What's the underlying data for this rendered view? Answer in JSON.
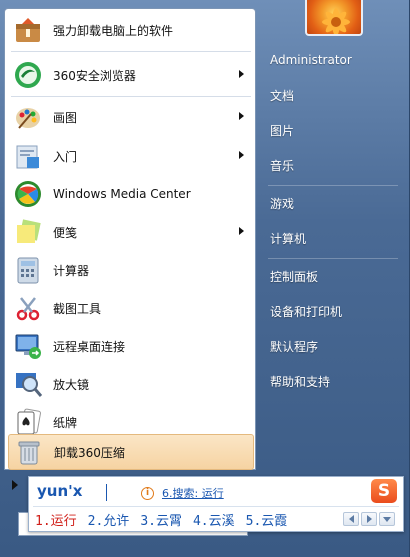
{
  "programs": [
    {
      "label": "强力卸载电脑上的软件",
      "icon": "uninstall-box-icon",
      "has_submenu": false
    },
    {
      "label": "360安全浏览器",
      "icon": "360-browser-icon",
      "has_submenu": true
    },
    {
      "label": "画图",
      "icon": "paint-palette-icon",
      "has_submenu": true
    },
    {
      "label": "入门",
      "icon": "getting-started-icon",
      "has_submenu": true
    },
    {
      "label": "Windows Media Center",
      "icon": "media-center-icon",
      "has_submenu": false
    },
    {
      "label": "便笺",
      "icon": "sticky-notes-icon",
      "has_submenu": true
    },
    {
      "label": "计算器",
      "icon": "calculator-icon",
      "has_submenu": false
    },
    {
      "label": "截图工具",
      "icon": "snipping-tool-icon",
      "has_submenu": false
    },
    {
      "label": "远程桌面连接",
      "icon": "remote-desktop-icon",
      "has_submenu": false
    },
    {
      "label": "放大镜",
      "icon": "magnifier-icon",
      "has_submenu": false
    },
    {
      "label": "纸牌",
      "icon": "solitaire-icon",
      "has_submenu": false
    },
    {
      "label": "卸载360压缩",
      "icon": "recycle-bin-icon",
      "has_submenu": false,
      "selected": true
    }
  ],
  "places": [
    {
      "label": "Administrator"
    },
    {
      "label": "文档"
    },
    {
      "label": "图片"
    },
    {
      "label": "音乐"
    },
    {
      "label": "游戏"
    },
    {
      "label": "计算机"
    },
    {
      "label": "控制面板"
    },
    {
      "label": "设备和打印机"
    },
    {
      "label": "默认程序"
    },
    {
      "label": "帮助和支持"
    }
  ],
  "ime": {
    "composition": "yun'x",
    "hint_text": "6.搜索: 运行",
    "logo": "S",
    "candidates": [
      "1.运行",
      "2.允许",
      "3.云霄",
      "4.云溪",
      "5.云霞"
    ]
  },
  "colors": {
    "selected_bg": "#f6d3a2",
    "ime_text": "#1a57b0",
    "ime_first": "#d0201a",
    "frame": "#4a6a95"
  }
}
